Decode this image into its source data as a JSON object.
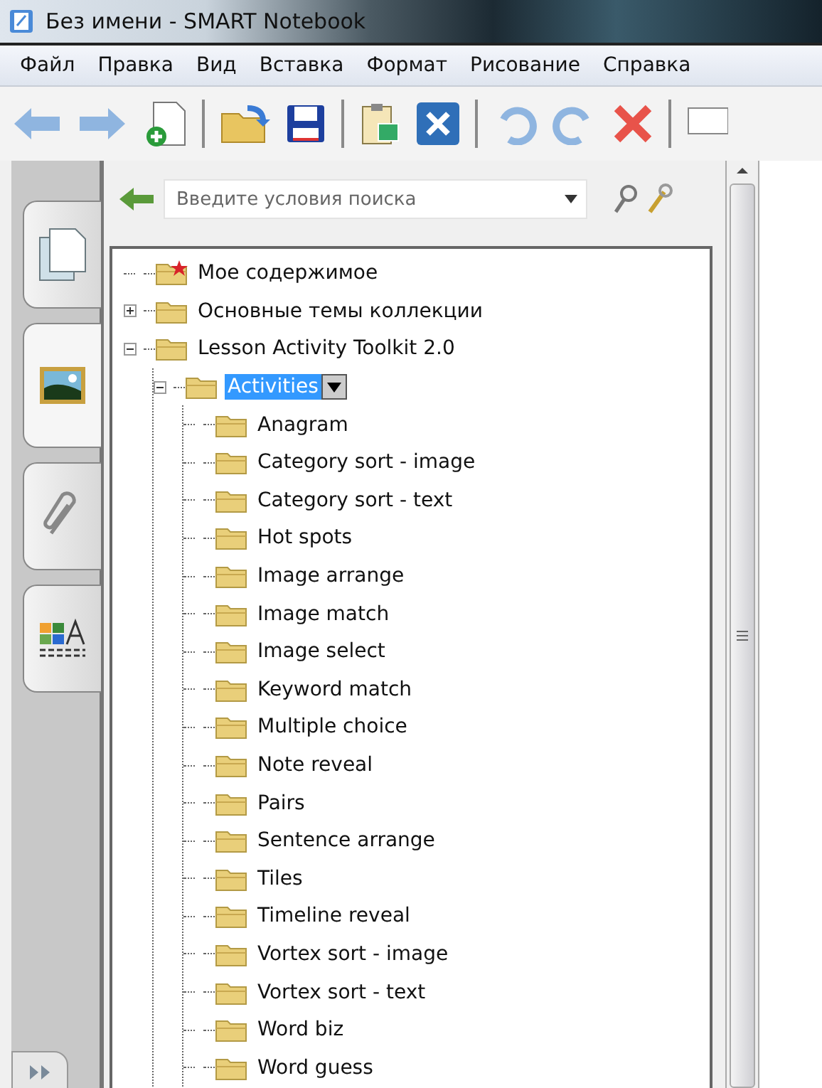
{
  "window": {
    "title": "Без имени - SMART Notebook"
  },
  "menu": [
    "Файл",
    "Правка",
    "Вид",
    "Вставка",
    "Формат",
    "Рисование",
    "Справка"
  ],
  "side_tabs": [
    {
      "kind": "pages",
      "selected": false
    },
    {
      "kind": "gallery",
      "selected": true
    },
    {
      "kind": "attachments",
      "selected": false
    },
    {
      "kind": "properties",
      "selected": false
    }
  ],
  "search": {
    "placeholder": "Введите условия поиска"
  },
  "tree": [
    {
      "label": "Мое содержимое",
      "kind": "starred",
      "selected": false
    },
    {
      "label": "Основные темы коллекции",
      "kind": "folder",
      "expanded": false,
      "selected": false
    },
    {
      "label": "Lesson Activity Toolkit 2.0",
      "kind": "folder",
      "expanded": true,
      "selected": false,
      "children": [
        {
          "label": "Activities",
          "kind": "folder",
          "expanded": true,
          "selected": true,
          "children": [
            {
              "label": "Anagram",
              "kind": "folder",
              "selected": false
            },
            {
              "label": "Category sort - image",
              "kind": "folder",
              "selected": false
            },
            {
              "label": "Category sort - text",
              "kind": "folder",
              "selected": false
            },
            {
              "label": "Hot spots",
              "kind": "folder",
              "selected": false
            },
            {
              "label": "Image arrange",
              "kind": "folder",
              "selected": false
            },
            {
              "label": "Image match",
              "kind": "folder",
              "selected": false
            },
            {
              "label": "Image select",
              "kind": "folder",
              "selected": false
            },
            {
              "label": "Keyword match",
              "kind": "folder",
              "selected": false
            },
            {
              "label": "Multiple choice",
              "kind": "folder",
              "selected": false
            },
            {
              "label": "Note reveal",
              "kind": "folder",
              "selected": false
            },
            {
              "label": "Pairs",
              "kind": "folder",
              "selected": false
            },
            {
              "label": "Sentence arrange",
              "kind": "folder",
              "selected": false
            },
            {
              "label": "Tiles",
              "kind": "folder",
              "selected": false
            },
            {
              "label": "Timeline reveal",
              "kind": "folder",
              "selected": false
            },
            {
              "label": "Vortex sort - image",
              "kind": "folder",
              "selected": false
            },
            {
              "label": "Vortex sort - text",
              "kind": "folder",
              "selected": false
            },
            {
              "label": "Word biz",
              "kind": "folder",
              "selected": false
            },
            {
              "label": "Word guess",
              "kind": "folder",
              "selected": false
            }
          ]
        }
      ]
    }
  ]
}
